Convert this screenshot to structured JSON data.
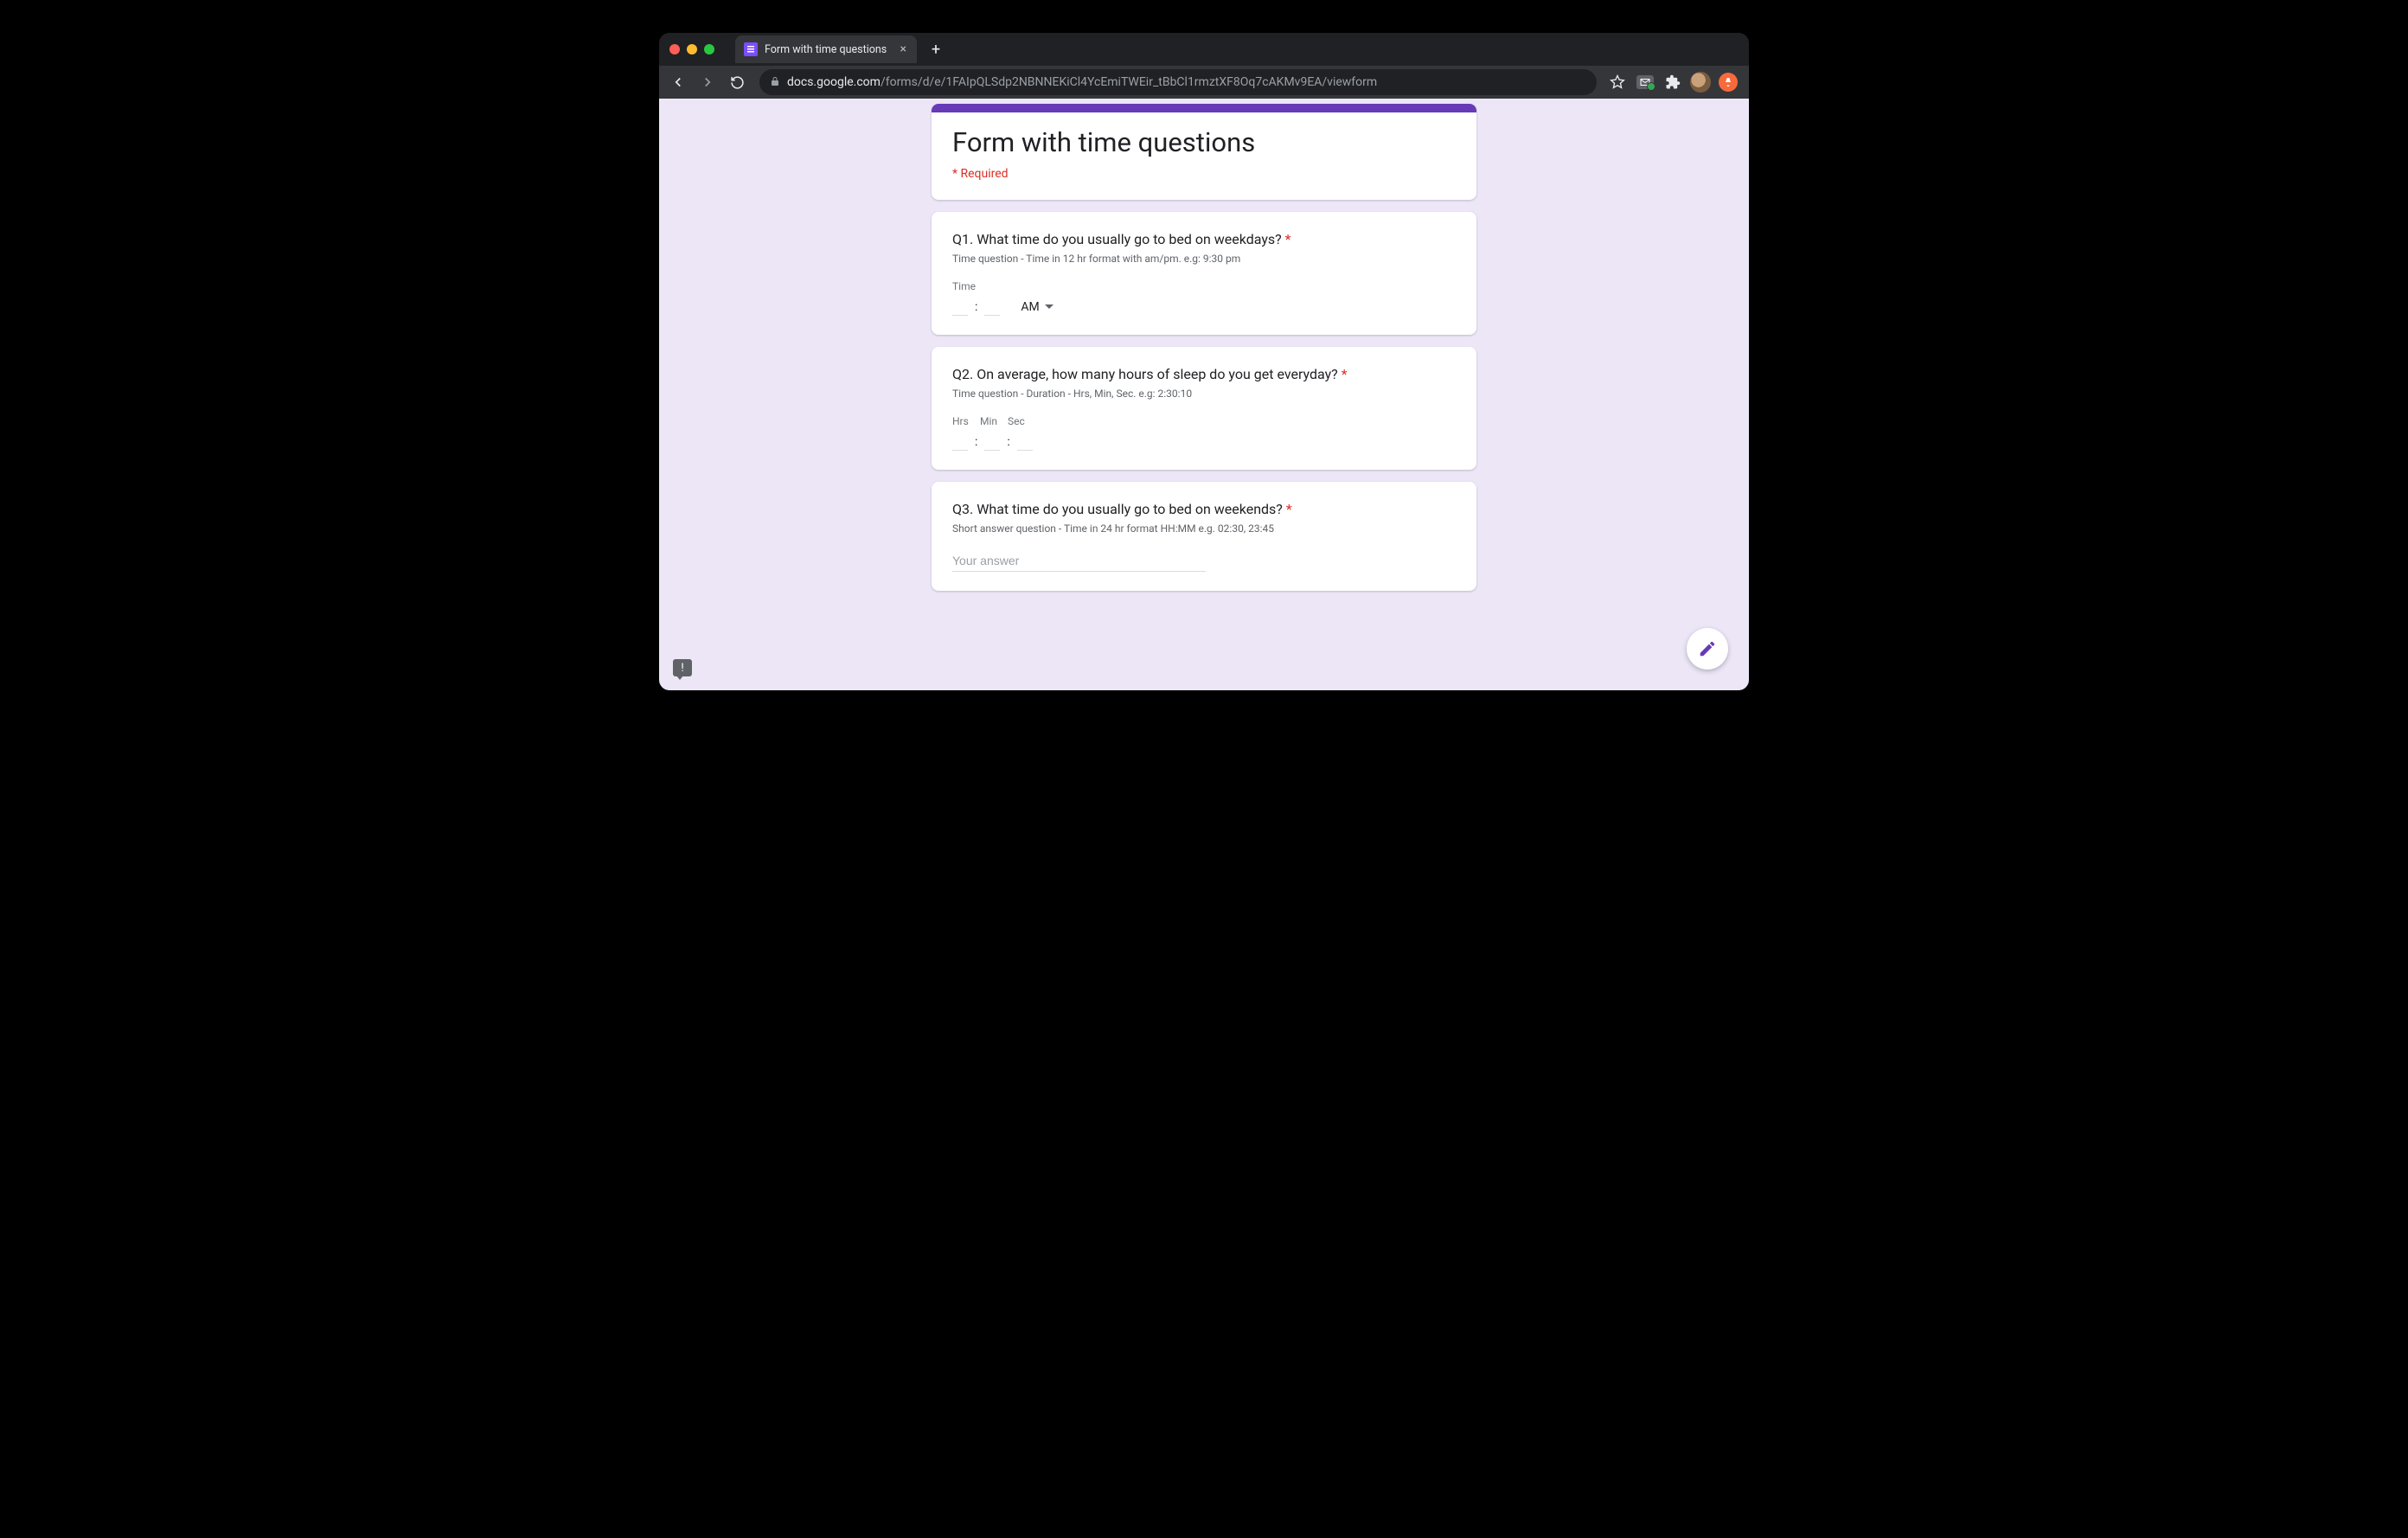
{
  "browser": {
    "tab_title": "Form with time questions",
    "url_host": "docs.google.com",
    "url_path": "/forms/d/e/1FAIpQLSdp2NBNNEKiCl4YcEmiTWEir_tBbCl1rmztXF8Oq7cAKMv9EA/viewform"
  },
  "form": {
    "title": "Form with time questions",
    "required_note": "* Required",
    "q1": {
      "title": "Q1. What time do you usually go to bed on weekdays?",
      "required": "*",
      "desc": "Time question - Time in 12 hr format with am/pm. e.g: 9:30 pm",
      "time_label": "Time",
      "ampm": "AM"
    },
    "q2": {
      "title": "Q2. On average, how many hours of sleep do you get everyday?",
      "required": "*",
      "desc": "Time question - Duration - Hrs, Min, Sec. e.g: 2:30:10",
      "hrs": "Hrs",
      "min": "Min",
      "sec": "Sec"
    },
    "q3": {
      "title": "Q3. What time do you usually go to bed on weekends?",
      "required": "*",
      "desc": "Short answer question - Time in 24 hr format HH:MM e.g. 02:30, 23:45",
      "placeholder": "Your answer"
    }
  }
}
